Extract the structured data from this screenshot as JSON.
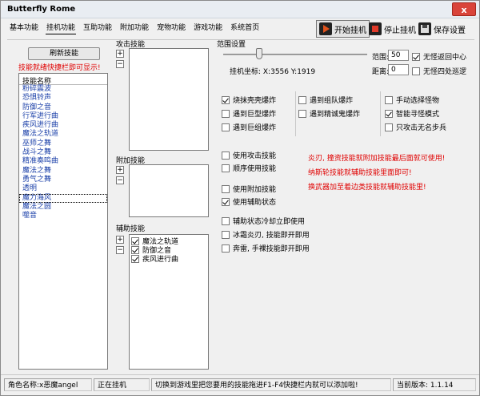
{
  "window": {
    "title": "Butterfly Rome",
    "close_label": "x"
  },
  "menu": [
    "基本功能",
    "挂机功能",
    "互助功能",
    "附加功能",
    "宠物功能",
    "游戏功能",
    "系统首页"
  ],
  "toolbar": {
    "start_label": "开始挂机",
    "stop_label": "停止挂机",
    "save_label": "保存设置"
  },
  "left_panel": {
    "refresh_label": "刷新技能",
    "hint": "技能就绪快捷栏即可显示!",
    "list_header": "技能名称",
    "skills": [
      "粉碎震波",
      "恐惧铃声",
      "防御之音",
      "行军进行曲",
      "疾风进行曲",
      "魔法之轨道",
      "巫师之舞",
      "战斗之舞",
      "精准奏鸣曲",
      "魔法之舞",
      "勇气之舞",
      "透明",
      "魔力海风",
      "魔法之圆",
      "噬音"
    ],
    "selected_index": 12
  },
  "attack": {
    "label": "攻击技能",
    "plus": "+",
    "minus": "−"
  },
  "extra": {
    "label": "附加技能",
    "plus": "+",
    "minus": "−"
  },
  "aux": {
    "label": "辅助技能",
    "plus": "+",
    "minus": "−",
    "items": [
      "魔法之轨道",
      "防御之音",
      "疾风进行曲"
    ]
  },
  "range": {
    "label": "范围设置",
    "range_label": "范围:",
    "range_value": "50",
    "no_return_label": "无怪返回中心",
    "distance_label": "距离:",
    "distance_value": "0",
    "no_patrol_label": "无怪四处巡逻",
    "coords_label": "挂机坐标: X:3556 Y:1919",
    "slider_fraction": 0.25
  },
  "options": {
    "opt1": "烧抹壳壳爆炸",
    "opt2": "遇到组队爆炸",
    "opt3": "手动选择怪物",
    "opt4": "遇到巨型爆炸",
    "opt5": "遇到精诚鬼爆炸",
    "opt6": "智能寻怪模式",
    "opt7": "遇到巨组爆炸",
    "opt8": "只攻击无名步兵"
  },
  "skill_opts": {
    "use_attack": "使用攻击技能",
    "seq_use": "顺序使用技能",
    "use_extra": "使用附加技能",
    "use_aux": "使用辅助状态",
    "aux_cooldown": "辅助状态冷却立即使用",
    "ice_flame": "冰霜炎刃, 技能即开即用",
    "rush": "奔雷, 手裸技能即开即用"
  },
  "notes": [
    "炎刃, 撞资技能就附加技能最后面就可使用!",
    "纳斯轮技能就辅助技能里面即可!",
    "换武器加至着边类技能就辅助技能里!"
  ],
  "status": {
    "role": "角色名称:x恶魔angel",
    "state": "正在挂机",
    "tip": "切换到游戏里把您要用的技能拖进F1-F4快捷栏内就可以添加啦!",
    "version": "当前版本: 1.1.14"
  },
  "colors": {
    "red_note": "#e00000",
    "skill_blue": "#1a3fa8"
  }
}
